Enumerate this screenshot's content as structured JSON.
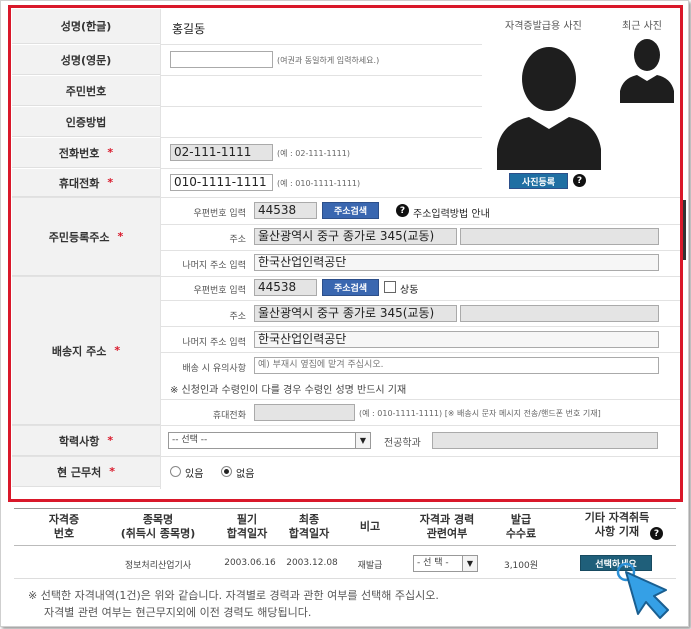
{
  "form": {
    "name_kr_label": "성명(한글)",
    "name_kr_value": "홍길동",
    "name_en_label": "성명(영문)",
    "name_en_hint": "(여권과 동일하게 입력하세요.)",
    "ssn_label": "주민번호",
    "auth_label": "인증방법",
    "phone_label": "전화번호",
    "phone_value": "02-111-1111",
    "phone_hint": "(예 : 02-111-1111)",
    "mobile_label": "휴대전화",
    "mobile_value": "010-1111-1111",
    "mobile_hint": "(예 : 010-1111-1111)",
    "required_mark": "*"
  },
  "photo": {
    "cert_title": "자격증발급용 사진",
    "recent_title": "최근 사진",
    "register_button": "사진등록"
  },
  "resident_address": {
    "label": "주민등록주소",
    "zip_label": "우편번호 입력",
    "zip_value": "44538",
    "search_button": "주소검색",
    "guide_text": "주소입력방법 안내",
    "address_label": "주소",
    "address_value": "울산광역시 중구 종가로 345(교동)",
    "detail_label": "나머지 주소 입력",
    "detail_value": "한국산업인력공단"
  },
  "delivery_address": {
    "label": "배송지 주소",
    "zip_label": "우편번호 입력",
    "zip_value": "44538",
    "search_button": "주소검색",
    "same_label": "상동",
    "address_label": "주소",
    "address_value": "울산광역시 중구 종가로 345(교동)",
    "detail_label": "나머지 주소 입력",
    "detail_value": "한국산업인력공단",
    "caution_label": "배송 시 유의사항",
    "caution_placeholder": "예) 부재시 옆집에 맡겨 주십시오.",
    "warning_text": "※ 신청인과 수령인이 다를 경우 수령인 성명 반드시 기재",
    "mobile_label": "휴대전화",
    "mobile_hint": "(예 : 010-1111-1111) [※ 배송시 문자 메시지 전송/핸드폰 번호 기재]"
  },
  "education": {
    "label": "학력사항",
    "select_value": "-- 선택 --",
    "major_label": "전공학과"
  },
  "employment": {
    "label": "현 근무처",
    "option_yes": "있음",
    "option_no": "없음"
  },
  "table": {
    "headers": {
      "cert_no_1": "자격증",
      "cert_no_2": "번호",
      "item_1": "종목명",
      "item_2": "(취득시 종목명)",
      "written_1": "필기",
      "written_2": "합격일자",
      "final_1": "최종",
      "final_2": "합격일자",
      "remark": "비고",
      "career_1": "자격과 경력",
      "career_2": "관련여부",
      "fee_1": "발급",
      "fee_2": "수수료",
      "other_1": "기타 자격취득",
      "other_2": "사항 기재"
    },
    "row": {
      "item": "정보처리산업기사",
      "written_date": "2003.06.16",
      "final_date": "2003.12.08",
      "remark": "재발급",
      "career_select": "- 선 택 -",
      "fee": "3,100원",
      "select_button": "선택하세요"
    }
  },
  "notes": {
    "line1": "※ 선택한 자격내역(1건)은 위와 같습니다. 자격별로 경력과 관한 여부를 선택해 주십시오.",
    "line2": "자격별 관련 여부는 현근무지외에 이전 경력도 해당됩니다."
  },
  "colors": {
    "highlight_border": "#d9182a",
    "button_blue": "#3a67b0",
    "select_button": "#1f5f7a",
    "cursor": "#2a8fd6"
  }
}
